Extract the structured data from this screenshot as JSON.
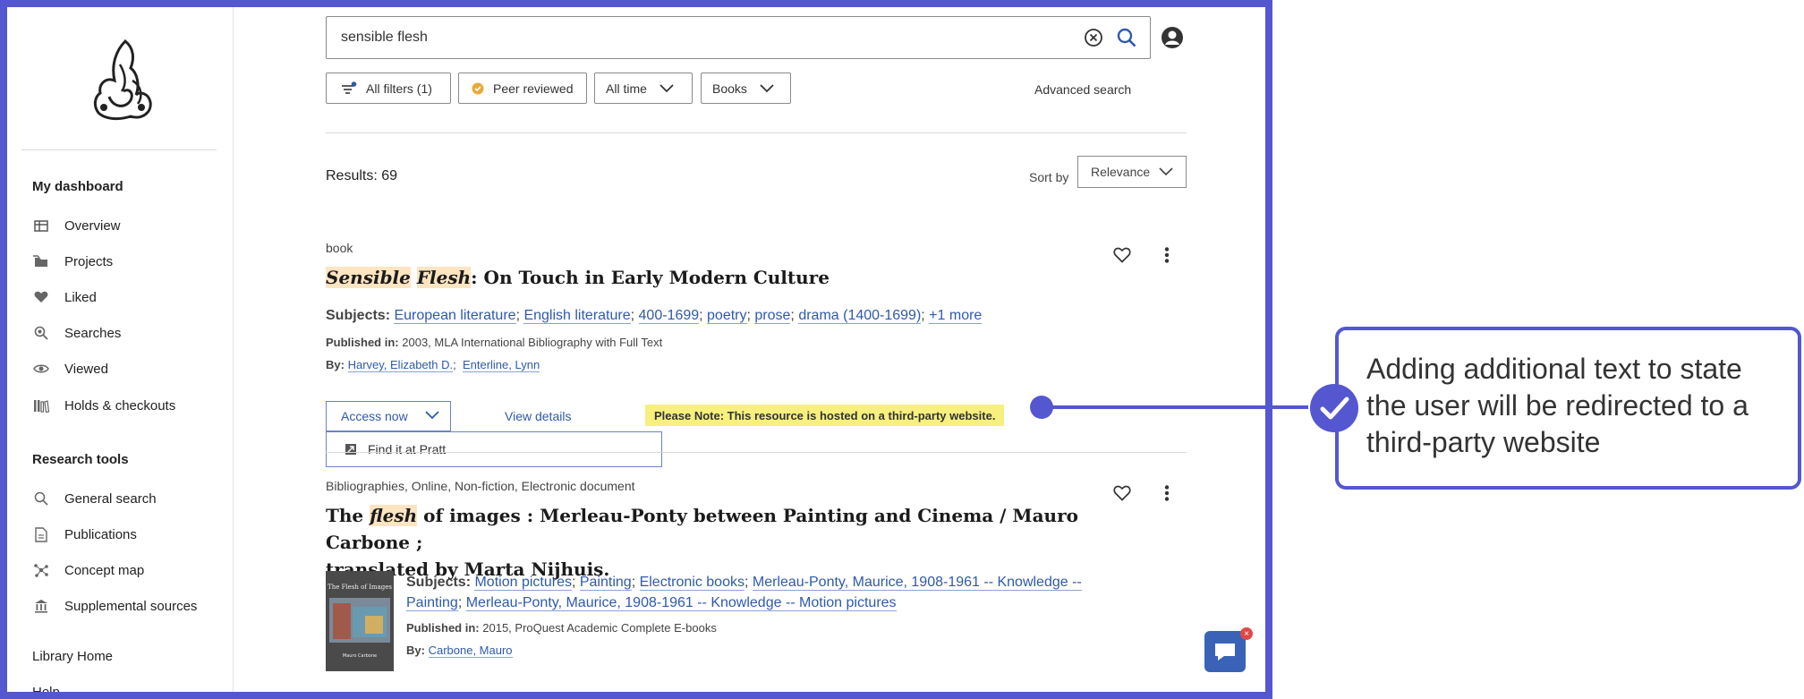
{
  "sidebar": {
    "dashboard_heading": "My dashboard",
    "dashboard_items": [
      {
        "label": "Overview",
        "icon": "columns-icon"
      },
      {
        "label": "Projects",
        "icon": "folder-icon"
      },
      {
        "label": "Liked",
        "icon": "heart-icon"
      },
      {
        "label": "Searches",
        "icon": "search-icon"
      },
      {
        "label": "Viewed",
        "icon": "eye-icon"
      },
      {
        "label": "Holds & checkouts",
        "icon": "books-icon"
      }
    ],
    "tools_heading": "Research tools",
    "tools_items": [
      {
        "label": "General search",
        "icon": "search-icon"
      },
      {
        "label": "Publications",
        "icon": "document-icon"
      },
      {
        "label": "Concept map",
        "icon": "concept-map-icon"
      },
      {
        "label": "Supplemental sources",
        "icon": "institution-icon"
      }
    ],
    "library_home": "Library Home",
    "help": "Help"
  },
  "search": {
    "value": "sensible flesh"
  },
  "filters": {
    "all_filters": "All filters (1)",
    "peer_reviewed": "Peer reviewed",
    "time": "All time",
    "type": "Books",
    "advanced": "Advanced search"
  },
  "results": {
    "count_text": "Results: 69",
    "sort_label": "Sort by",
    "sort_value": "Relevance"
  },
  "result1": {
    "type": "book",
    "title_hl1": "Sensible",
    "title_hl2": "Flesh",
    "title_rest": ": On Touch in Early Modern Culture",
    "subjects_label": "Subjects:",
    "subjects": [
      "European literature",
      "English literature",
      "400-1699",
      "poetry",
      "prose",
      "drama (1400-1699)"
    ],
    "more": "+1 more",
    "published_label": "Published in:",
    "published": "2003, MLA International Bibliography with Full Text",
    "by_label": "By:",
    "authors": [
      "Harvey, Elizabeth D.",
      "Enterline, Lynn"
    ],
    "access_label": "Access now",
    "view_details": "View details",
    "dropdown_item": "Find it at Pratt",
    "note": "Please Note: This resource is hosted on a third-party website."
  },
  "result2": {
    "type": "Bibliographies, Online, Non-fiction, Electronic document",
    "title_pre": "The",
    "title_hl": "flesh",
    "title_rest": "of images : Merleau-Ponty between Painting and Cinema / Mauro Carbone ;",
    "title_line2": "translated by Marta Nijhuis.",
    "subjects_label": "Subjects:",
    "subjects": [
      "Motion pictures",
      "Painting",
      "Electronic books",
      "Merleau-Ponty, Maurice, 1908-1961 -- Knowledge --",
      "Painting",
      "Merleau-Ponty, Maurice, 1908-1961 -- Knowledge -- Motion pictures"
    ],
    "published_label": "Published in:",
    "published": "2015, ProQuest Academic Complete E-books",
    "by_label": "By:",
    "author": "Carbone, Mauro",
    "cover_title": "The Flesh of Images",
    "cover_author": "Mauro Carbone"
  },
  "annotation": {
    "text": "Adding additional text to state the user will be redirected to a third-party website"
  },
  "colors": {
    "frame": "#5457cf",
    "link": "#2e5aac",
    "highlight": "#fde5c2",
    "note_bg": "#f7ef7e"
  }
}
